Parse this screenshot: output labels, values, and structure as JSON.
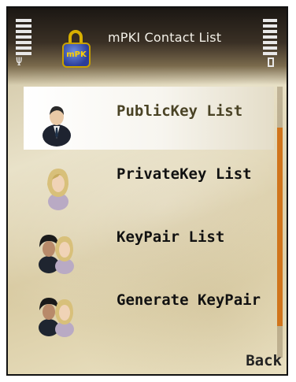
{
  "app": {
    "title": "mPKI Contact List",
    "app_icon_text": "mPK"
  },
  "menu": {
    "items": [
      {
        "label": "PublicKey List",
        "icon": "businessman-icon",
        "selected": true
      },
      {
        "label": "PrivateKey List",
        "icon": "woman-icon",
        "selected": false
      },
      {
        "label": "KeyPair List",
        "icon": "user-pair-icon",
        "selected": false
      },
      {
        "label": "Generate KeyPair",
        "icon": "user-pair-icon",
        "selected": false
      }
    ]
  },
  "softkeys": {
    "right": "Back"
  },
  "colors": {
    "accent": "#d0741b",
    "header": "#1b1713",
    "selected_text": "#4a4325"
  },
  "indicators": {
    "signal_icon": "signal-strength-icon",
    "battery_icon": "battery-icon"
  }
}
